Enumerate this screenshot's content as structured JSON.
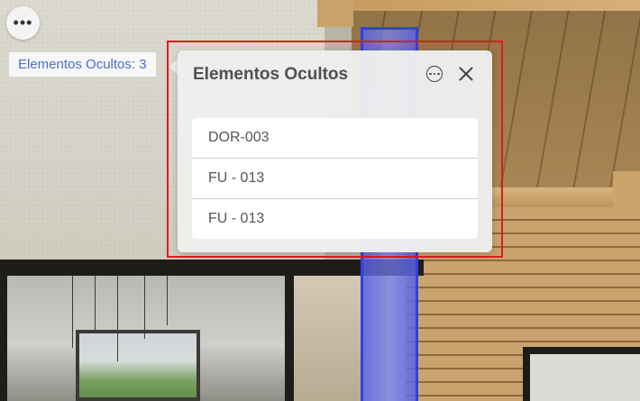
{
  "toolbar": {
    "more_icon": "more-horizontal-icon",
    "more_glyph": "•••"
  },
  "hidden_count": {
    "label": "Elementos Ocultos: 3"
  },
  "panel": {
    "title": "Elementos Ocultos",
    "options_icon": "more-circle-icon",
    "close_icon": "close-icon",
    "items": [
      {
        "label": "DOR-003"
      },
      {
        "label": "FU - 013"
      },
      {
        "label": "FU - 013"
      }
    ]
  },
  "colors": {
    "highlight_border": "#e01b1b",
    "hidden_element_highlight": "#5862e6",
    "link_text": "#4a6ed1"
  }
}
